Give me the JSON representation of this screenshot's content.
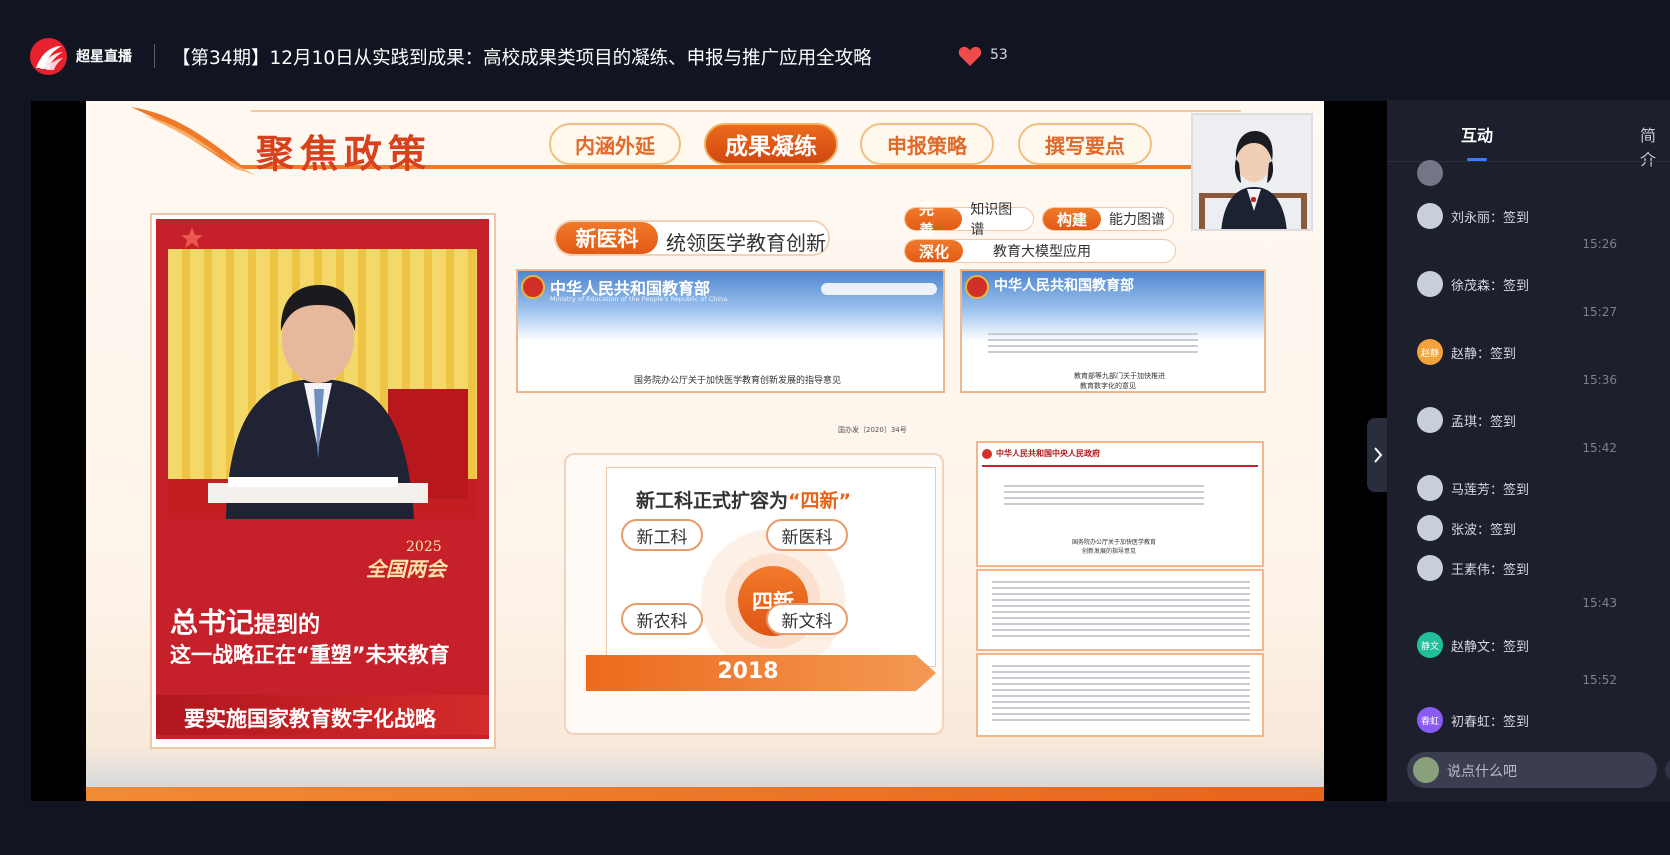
{
  "header": {
    "brand": "超星直播",
    "title": "【第34期】12月10日从实践到成果：高校成果类项目的凝练、申报与推广应用全攻略",
    "like_count": "53",
    "like_color": "#f04b4b"
  },
  "slide": {
    "heading": "聚焦政策",
    "nav": [
      "内涵外延",
      "成果凝练",
      "申报策略",
      "撰写要点"
    ],
    "active_nav": "成果凝练",
    "poster": {
      "year": "2025",
      "event": "全国两会",
      "line1_big": "总书记",
      "line1_rest": "提到的",
      "line2": "这一战略正在“重塑”未来教育",
      "caption": "要实施国家教育数字化战略"
    },
    "new_med_tag": "新医科",
    "new_med_text": "统领医学教育创新",
    "mini_tags": [
      {
        "key": "完善",
        "text": "知识图谱"
      },
      {
        "key": "构建",
        "text": "能力图谱"
      },
      {
        "key": "深化",
        "text": "教育大模型应用"
      }
    ],
    "doc1": {
      "org": "中华人民共和国教育部",
      "org_en": "Ministry of Education of the People's Republic of China",
      "body": "国务院办公厅关于加快医学教育创新发展的指导意见",
      "ref": "国办发〔2020〕34号"
    },
    "doc2": {
      "org": "中华人民共和国教育部",
      "body1": "教育部等九部门关于加快推进",
      "body2": "教育数字化的意见"
    },
    "doc3": {
      "org": "中华人民共和国中央人民政府",
      "body1": "国务院办公厅关于加快医学教育",
      "body2": "创新发展的指导意见"
    },
    "four_new": {
      "heading_pre": "新工科正式扩容为",
      "heading_hl": "“四新”",
      "center": "四新",
      "nodes": [
        "新工科",
        "新医科",
        "新农科",
        "新文科"
      ],
      "year": "2018"
    }
  },
  "sidebar": {
    "tabs": [
      "互动",
      "简介"
    ],
    "active_tab": "互动",
    "messages": [
      {
        "type": "msg",
        "name": "刘永丽",
        "text": "签到",
        "avatar": ""
      },
      {
        "type": "time",
        "text": "15:26"
      },
      {
        "type": "msg",
        "name": "徐茂森",
        "text": "签到",
        "avatar": ""
      },
      {
        "type": "time",
        "text": "15:27"
      },
      {
        "type": "msg",
        "name": "赵静",
        "text": "签到",
        "avatar": "赵静",
        "color": "#f2a33a"
      },
      {
        "type": "time",
        "text": "15:36"
      },
      {
        "type": "msg",
        "name": "孟琪",
        "text": "签到",
        "avatar": ""
      },
      {
        "type": "time",
        "text": "15:42"
      },
      {
        "type": "msg",
        "name": "马莲芳",
        "text": "签到",
        "avatar": ""
      },
      {
        "type": "msg",
        "name": "张波",
        "text": "签到",
        "avatar": ""
      },
      {
        "type": "msg",
        "name": "王素伟",
        "text": "签到",
        "avatar": ""
      },
      {
        "type": "time",
        "text": "15:43"
      },
      {
        "type": "msg",
        "name": "赵静文",
        "text": "签到",
        "avatar": "静文",
        "color": "#1fbf9a"
      },
      {
        "type": "time",
        "text": "15:52"
      },
      {
        "type": "msg",
        "name": "初春虹",
        "text": "签到",
        "avatar": "春虹",
        "color": "#8a5cf6"
      }
    ],
    "input_placeholder": "说点什么吧"
  }
}
